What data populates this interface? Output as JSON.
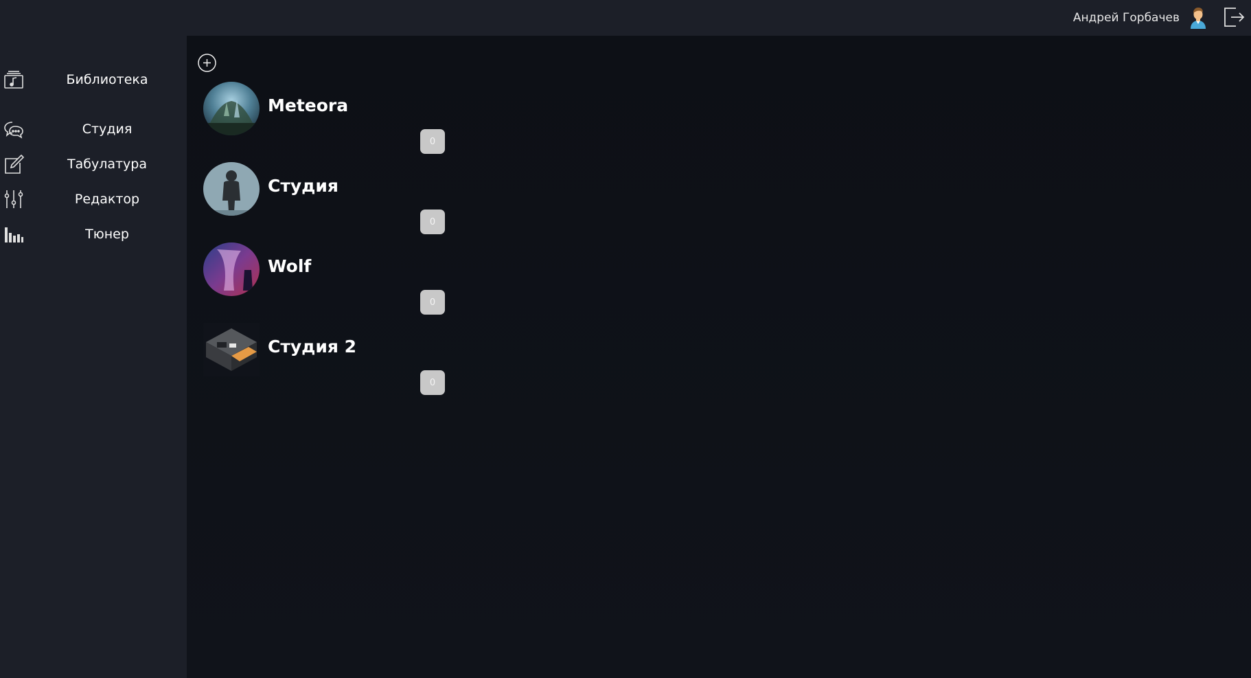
{
  "header": {
    "user_name": "Андрей Горбачев",
    "avatar_icon": "user-avatar-icon",
    "logout_icon": "logout-icon"
  },
  "sidebar": {
    "items": [
      {
        "label": "Библиотека",
        "icon": "music-library-icon"
      },
      {
        "label": "Студия",
        "icon": "chat-bubbles-icon"
      },
      {
        "label": "Табулатура",
        "icon": "edit-icon"
      },
      {
        "label": "Редактор",
        "icon": "sliders-icon"
      },
      {
        "label": "Тюнер",
        "icon": "equalizer-icon"
      }
    ]
  },
  "main": {
    "add_icon": "plus-circle-icon",
    "studios": [
      {
        "name": "Meteora",
        "count": "0"
      },
      {
        "name": "Студия",
        "count": "0"
      },
      {
        "name": "Wolf",
        "count": "0"
      },
      {
        "name": "Студия 2",
        "count": "0"
      }
    ]
  },
  "colors": {
    "topbar": "#1c1f28",
    "sidebar": "#1c1f28",
    "main_bg": "#10131a",
    "badge": "#c8c8c8"
  }
}
